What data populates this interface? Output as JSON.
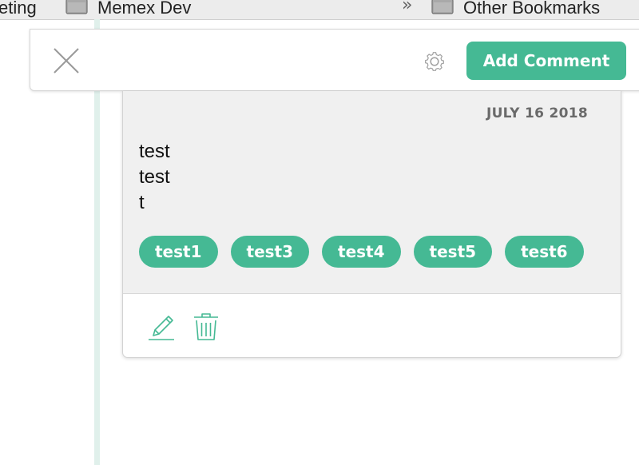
{
  "bookmarks_bar": {
    "items": [
      {
        "label": "eting"
      },
      {
        "label": "Memex Dev"
      },
      {
        "label": "Other Bookmarks"
      }
    ],
    "overflow_glyph": "»"
  },
  "toolbar": {
    "close_icon": "close-icon",
    "settings_icon": "gear-icon",
    "add_comment_label": "Add Comment"
  },
  "comment": {
    "date": "JULY 16 2018",
    "text": "test\ntest\nt",
    "tags": [
      "test1",
      "test3",
      "test4",
      "test5",
      "test6"
    ],
    "actions": {
      "edit_icon": "pencil-icon",
      "delete_icon": "trash-icon"
    }
  },
  "colors": {
    "accent": "#45b994",
    "sidebar_line": "#e0f0eb",
    "card_background": "#f0f0f0",
    "date_text": "#6a6a6a"
  }
}
